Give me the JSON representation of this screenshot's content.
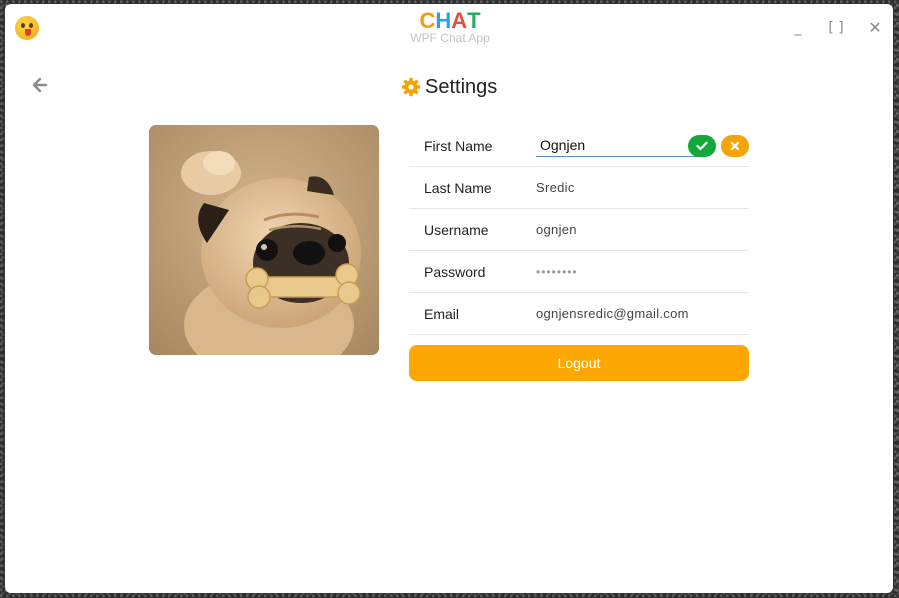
{
  "app": {
    "icon": "tongue-emoji-icon",
    "logo_letters": [
      {
        "char": "C",
        "color": "#f39c12"
      },
      {
        "char": "H",
        "color": "#2e9fe0"
      },
      {
        "char": "A",
        "color": "#e74c3c"
      },
      {
        "char": "T",
        "color": "#27ae60"
      }
    ],
    "subtitle": "WPF Chat App"
  },
  "window_controls": {
    "minimize": "_",
    "maximize": "[ ]",
    "close": "✕"
  },
  "page": {
    "back_icon": "arrow-left-icon",
    "header_icon": "gear-icon",
    "title": "Settings"
  },
  "profile": {
    "avatar_icon": "pug-photo"
  },
  "fields": [
    {
      "label": "First Name",
      "value": "Ognjen",
      "editing": true
    },
    {
      "label": "Last Name",
      "value": "Sredic"
    },
    {
      "label": "Username",
      "value": "ognjen"
    },
    {
      "label": "Password",
      "value": "••••••••"
    },
    {
      "label": "Email",
      "value": "ognjensredic@gmail.com"
    }
  ],
  "edit_actions": {
    "confirm_icon": "check-icon",
    "cancel_icon": "close-icon",
    "confirm_color": "#14a83b",
    "cancel_color": "#f6a30b"
  },
  "logout_label": "Logout",
  "colors": {
    "accent": "#fea602",
    "input_underline": "#5b8ec6"
  }
}
